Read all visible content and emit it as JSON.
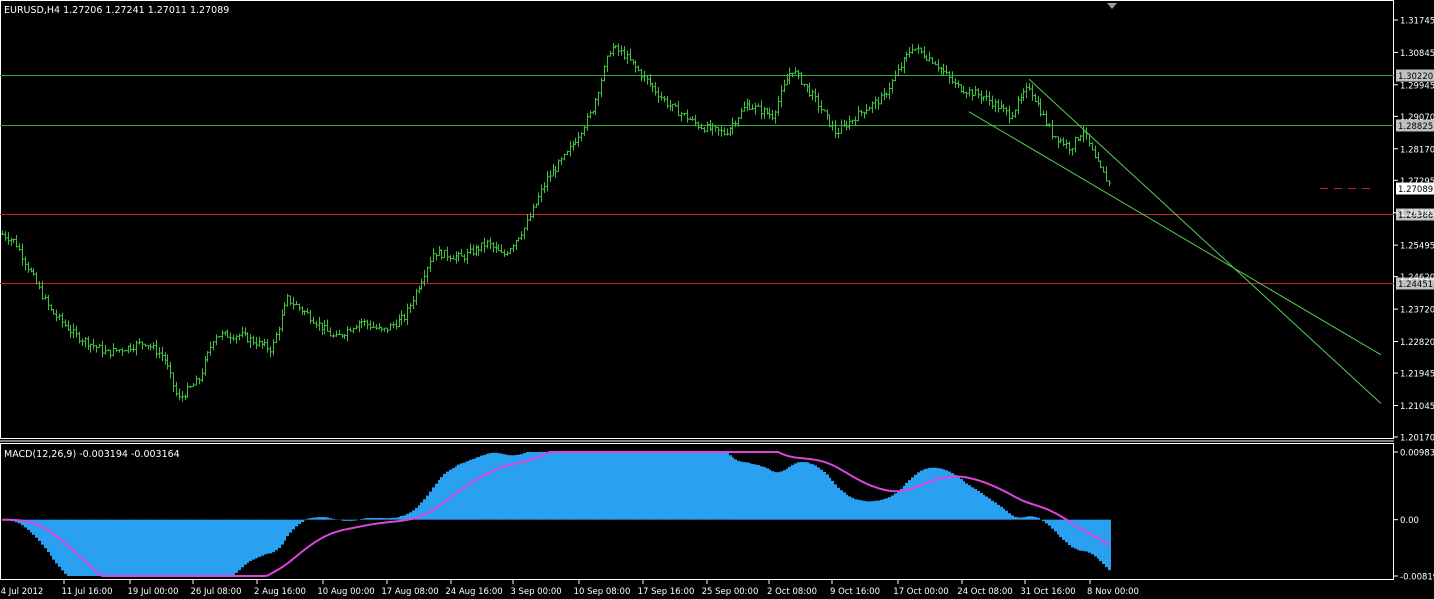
{
  "colors": {
    "background": "#000000",
    "candle": "#3fbf3f",
    "grid_frame": "#ffffff",
    "support_line": "#33aa33",
    "resistance_line": "#cc2222",
    "trend_line": "#55cc55",
    "macd_histogram": "#2aa0f0",
    "macd_signal": "#dd44dd",
    "price_label_bg": "#c0c0c0",
    "price_label_text": "#000000",
    "current_price_bg": "#ffffff"
  },
  "price_panel": {
    "header": "EURUSD,H4  1.27206 1.27241 1.27011 1.27089",
    "axis_labels": [
      "1.31745",
      "1.30845",
      "1.29945",
      "1.29070",
      "1.28170",
      "1.27295",
      "1.26395",
      "1.25495",
      "1.24620",
      "1.23720",
      "1.22820",
      "1.21945",
      "1.21045",
      "1.20170"
    ],
    "axis_values": [
      1.31745,
      1.30845,
      1.29945,
      1.2907,
      1.2817,
      1.27295,
      1.26395,
      1.25495,
      1.2462,
      1.2372,
      1.2282,
      1.21945,
      1.21045,
      1.2017
    ],
    "ylim": [
      1.2017,
      1.31745
    ],
    "level_labels": {
      "green_upper": "1.30220",
      "green_lower": "1.28825",
      "current": "1.27089",
      "red_upper": "1.26366",
      "red_lower": "1.24451"
    },
    "levels": {
      "green_upper": 1.3022,
      "green_lower": 1.28825,
      "current": 1.27089,
      "red_upper": 1.26366,
      "red_lower": 1.24451
    }
  },
  "macd_panel": {
    "header": "MACD(12,26,9) -0.003194 -0.003164",
    "axis_labels": [
      "0.009838",
      "0.00",
      "-0.00819"
    ],
    "axis_values": [
      0.009838,
      0.0,
      -0.00819
    ]
  },
  "time_axis": {
    "labels": [
      "4 Jul 2012",
      "11 Jul 16:00",
      "19 Jul 00:00",
      "26 Jul 08:00",
      "2 Aug 16:00",
      "10 Aug 00:00",
      "17 Aug 08:00",
      "24 Aug 16:00",
      "3 Sep 00:00",
      "10 Sep 08:00",
      "17 Sep 16:00",
      "25 Sep 00:00",
      "2 Oct 08:00",
      "9 Oct 16:00",
      "17 Oct 00:00",
      "24 Oct 08:00",
      "31 Oct 16:00",
      "8 Nov 00:00"
    ]
  },
  "chart_data": {
    "type": "line",
    "title": "EURUSD,H4",
    "series_price_anchors": [
      {
        "t": 0,
        "p": 1.258
      },
      {
        "t": 0.4,
        "p": 1.256
      },
      {
        "t": 1.5,
        "p": 1.237
      },
      {
        "t": 2.3,
        "p": 1.23
      },
      {
        "t": 3.3,
        "p": 1.225
      },
      {
        "t": 4.5,
        "p": 1.228
      },
      {
        "t": 5.1,
        "p": 1.224
      },
      {
        "t": 5.55,
        "p": 1.212
      },
      {
        "t": 6.2,
        "p": 1.2175
      },
      {
        "t": 6.7,
        "p": 1.23
      },
      {
        "t": 7.5,
        "p": 1.23
      },
      {
        "t": 8.5,
        "p": 1.226
      },
      {
        "t": 9.0,
        "p": 1.24
      },
      {
        "t": 9.6,
        "p": 1.236
      },
      {
        "t": 10.5,
        "p": 1.229
      },
      {
        "t": 11.3,
        "p": 1.234
      },
      {
        "t": 12.0,
        "p": 1.231
      },
      {
        "t": 12.7,
        "p": 1.235
      },
      {
        "t": 13.6,
        "p": 1.253
      },
      {
        "t": 14.5,
        "p": 1.2515
      },
      {
        "t": 15.3,
        "p": 1.2555
      },
      {
        "t": 15.8,
        "p": 1.252
      },
      {
        "t": 16.5,
        "p": 1.26
      },
      {
        "t": 17.2,
        "p": 1.2735
      },
      {
        "t": 17.8,
        "p": 1.28
      },
      {
        "t": 18.6,
        "p": 1.292
      },
      {
        "t": 19.2,
        "p": 1.31
      },
      {
        "t": 19.6,
        "p": 1.308
      },
      {
        "t": 20.4,
        "p": 1.3
      },
      {
        "t": 21.0,
        "p": 1.294
      },
      {
        "t": 22.0,
        "p": 1.288
      },
      {
        "t": 22.8,
        "p": 1.286
      },
      {
        "t": 23.5,
        "p": 1.294
      },
      {
        "t": 24.3,
        "p": 1.291
      },
      {
        "t": 24.9,
        "p": 1.304
      },
      {
        "t": 25.6,
        "p": 1.296
      },
      {
        "t": 26.3,
        "p": 1.286
      },
      {
        "t": 27.1,
        "p": 1.292
      },
      {
        "t": 27.8,
        "p": 1.296
      },
      {
        "t": 28.7,
        "p": 1.31
      },
      {
        "t": 29.4,
        "p": 1.306
      },
      {
        "t": 30.1,
        "p": 1.299
      },
      {
        "t": 31.0,
        "p": 1.296
      },
      {
        "t": 31.8,
        "p": 1.291
      },
      {
        "t": 32.4,
        "p": 1.299
      },
      {
        "t": 33.1,
        "p": 1.286
      },
      {
        "t": 33.7,
        "p": 1.282
      },
      {
        "t": 34.1,
        "p": 1.287
      },
      {
        "t": 34.5,
        "p": 1.278
      },
      {
        "t": 35.0,
        "p": 1.2709
      }
    ],
    "ylim": [
      1.2017,
      1.31745
    ],
    "trend_lines": [
      {
        "from": {
          "t": 30.5,
          "p": 1.292
        },
        "to": {
          "t": 43.5,
          "p": 1.2245
        }
      },
      {
        "from": {
          "t": 32.4,
          "p": 1.301
        },
        "to": {
          "t": 43.5,
          "p": 1.211
        }
      }
    ]
  }
}
